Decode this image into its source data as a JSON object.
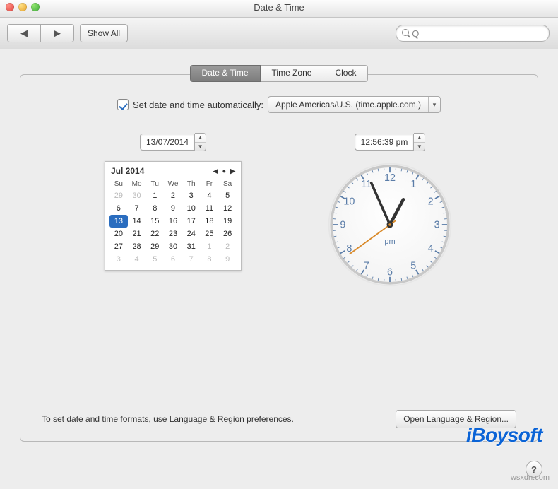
{
  "window": {
    "title": "Date & Time"
  },
  "toolbar": {
    "show_all_label": "Show All",
    "search_placeholder": ""
  },
  "search_icon_glyph": "Q",
  "tabs": {
    "date_time": "Date & Time",
    "time_zone": "Time Zone",
    "clock": "Clock",
    "selected": "date_time"
  },
  "auto": {
    "checked": true,
    "label": "Set date and time automatically:",
    "server": "Apple Americas/U.S. (time.apple.com.)"
  },
  "date": {
    "value": "13/07/2014"
  },
  "time": {
    "value": "12:56:39 pm",
    "ampm": "pm",
    "hour": 12,
    "minute": 56,
    "second": 39
  },
  "calendar": {
    "month_label": "Jul 2014",
    "dow": [
      "Su",
      "Mo",
      "Tu",
      "We",
      "Th",
      "Fr",
      "Sa"
    ],
    "weeks": [
      [
        {
          "n": 29,
          "o": 1
        },
        {
          "n": 30,
          "o": 1
        },
        {
          "n": 1
        },
        {
          "n": 2
        },
        {
          "n": 3
        },
        {
          "n": 4
        },
        {
          "n": 5
        }
      ],
      [
        {
          "n": 6
        },
        {
          "n": 7
        },
        {
          "n": 8
        },
        {
          "n": 9
        },
        {
          "n": 10
        },
        {
          "n": 11
        },
        {
          "n": 12
        }
      ],
      [
        {
          "n": 13,
          "sel": 1
        },
        {
          "n": 14
        },
        {
          "n": 15
        },
        {
          "n": 16
        },
        {
          "n": 17
        },
        {
          "n": 18
        },
        {
          "n": 19
        }
      ],
      [
        {
          "n": 20
        },
        {
          "n": 21
        },
        {
          "n": 22
        },
        {
          "n": 23
        },
        {
          "n": 24
        },
        {
          "n": 25
        },
        {
          "n": 26
        }
      ],
      [
        {
          "n": 27
        },
        {
          "n": 28
        },
        {
          "n": 29
        },
        {
          "n": 30
        },
        {
          "n": 31
        },
        {
          "n": 1,
          "o": 1
        },
        {
          "n": 2,
          "o": 1
        }
      ],
      [
        {
          "n": 3,
          "o": 1
        },
        {
          "n": 4,
          "o": 1
        },
        {
          "n": 5,
          "o": 1
        },
        {
          "n": 6,
          "o": 1
        },
        {
          "n": 7,
          "o": 1
        },
        {
          "n": 8,
          "o": 1
        },
        {
          "n": 9,
          "o": 1
        }
      ]
    ]
  },
  "clock_face": {
    "numerals": [
      "12",
      "1",
      "2",
      "3",
      "4",
      "5",
      "6",
      "7",
      "8",
      "9",
      "10",
      "11"
    ]
  },
  "footer": {
    "hint": "To set date and time formats, use Language & Region preferences.",
    "open_lang_region": "Open Language & Region..."
  },
  "watermark": "iBoysoft",
  "attribution": "wsxdn.com",
  "help_glyph": "?"
}
